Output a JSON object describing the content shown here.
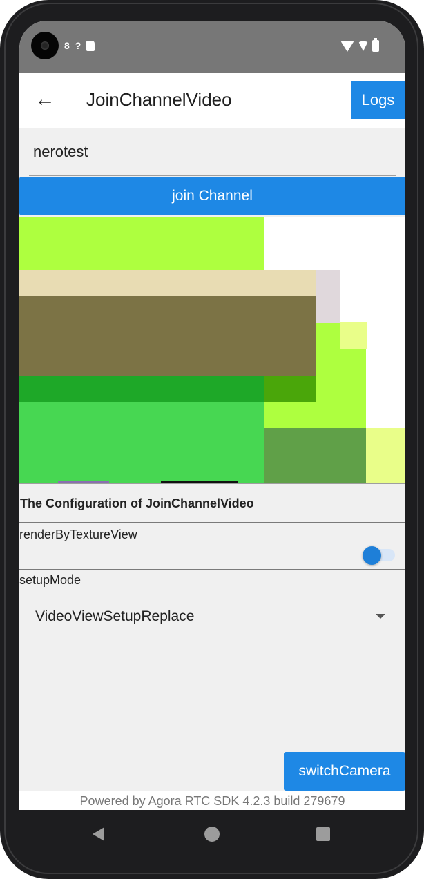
{
  "status_bar": {
    "left_icons": [
      "camera-cutout",
      "notification-glyph",
      "no-signal-icon",
      "sd-card-icon"
    ],
    "left_glyph": "8",
    "signal_glyph": "?",
    "right_icons": [
      "wifi-icon",
      "signal-icon",
      "battery-icon"
    ]
  },
  "app_bar": {
    "back_icon": "arrow-back-icon",
    "back_glyph": "←",
    "title": "JoinChannelVideo",
    "logs_label": "Logs"
  },
  "channel_input": {
    "value": "nerotest"
  },
  "join_button": {
    "label": "join Channel"
  },
  "video_view": {
    "colors": [
      "#aeff3f",
      "#e8dcb3",
      "#7c7345",
      "#1ea828",
      "#47d752",
      "#60a048",
      "#e9fe89"
    ]
  },
  "config": {
    "title": "The Configuration of JoinChannelVideo",
    "render_by_texture_label": "renderByTextureView",
    "render_by_texture_on": false,
    "setup_mode_label": "setupMode",
    "setup_mode_value": "VideoViewSetupReplace"
  },
  "switch_camera_button": {
    "label": "switchCamera"
  },
  "footer": {
    "text": "Powered by Agora RTC SDK 4.2.3 build 279679"
  },
  "nav_bar": {
    "icons": [
      "nav-back-icon",
      "nav-home-icon",
      "nav-recents-icon"
    ]
  },
  "colors": {
    "accent": "#1e88e5",
    "status_bar": "#777777",
    "background": "#f0f0f0"
  }
}
